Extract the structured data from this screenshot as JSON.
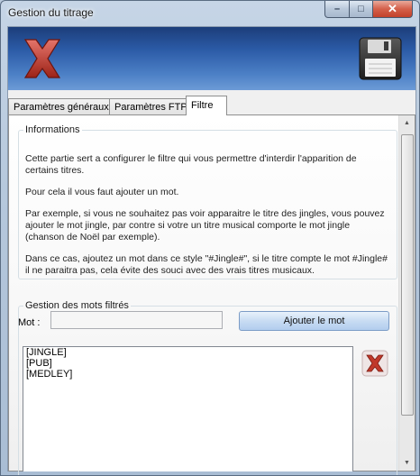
{
  "window": {
    "title": "Gestion du titrage"
  },
  "toolbar": {
    "cancel_icon": "red-x-icon",
    "save_icon": "floppy-disk-icon"
  },
  "tabs": [
    {
      "label": "Paramètres généraux",
      "active": false
    },
    {
      "label": "Paramètres FTP",
      "active": false
    },
    {
      "label": "Filtre",
      "active": true
    }
  ],
  "informations": {
    "legend": "Informations",
    "paragraphs": [
      "Cette partie sert a configurer le filtre qui vous permettre d'interdir l'apparition de certains titres.",
      "Pour cela il vous faut ajouter un mot.",
      "Par exemple, si vous ne souhaitez pas voir apparaitre le titre des jingles, vous pouvez ajouter le mot jingle, par contre si votre un titre musical comporte le mot jingle (chanson de Noël par exemple).",
      "Dans ce cas, ajoutez un mot dans ce style \"#Jingle#\", si le titre compte le mot #Jingle# il ne paraitra pas, cela évite des souci avec des vrais titres musicaux."
    ]
  },
  "gestion": {
    "legend": "Gestion des mots filtrés",
    "mot_label": "Mot :",
    "mot_value": "",
    "add_button": "Ajouter le mot",
    "items": [
      "[JINGLE]",
      "[PUB]",
      "[MEDLEY]"
    ],
    "delete_icon": "delete-x-icon"
  },
  "colors": {
    "toolbar_top": "#1c3e7a",
    "toolbar_bottom": "#6d9bd6",
    "x_red": "#c0392b",
    "close_button": "#c2412b"
  }
}
